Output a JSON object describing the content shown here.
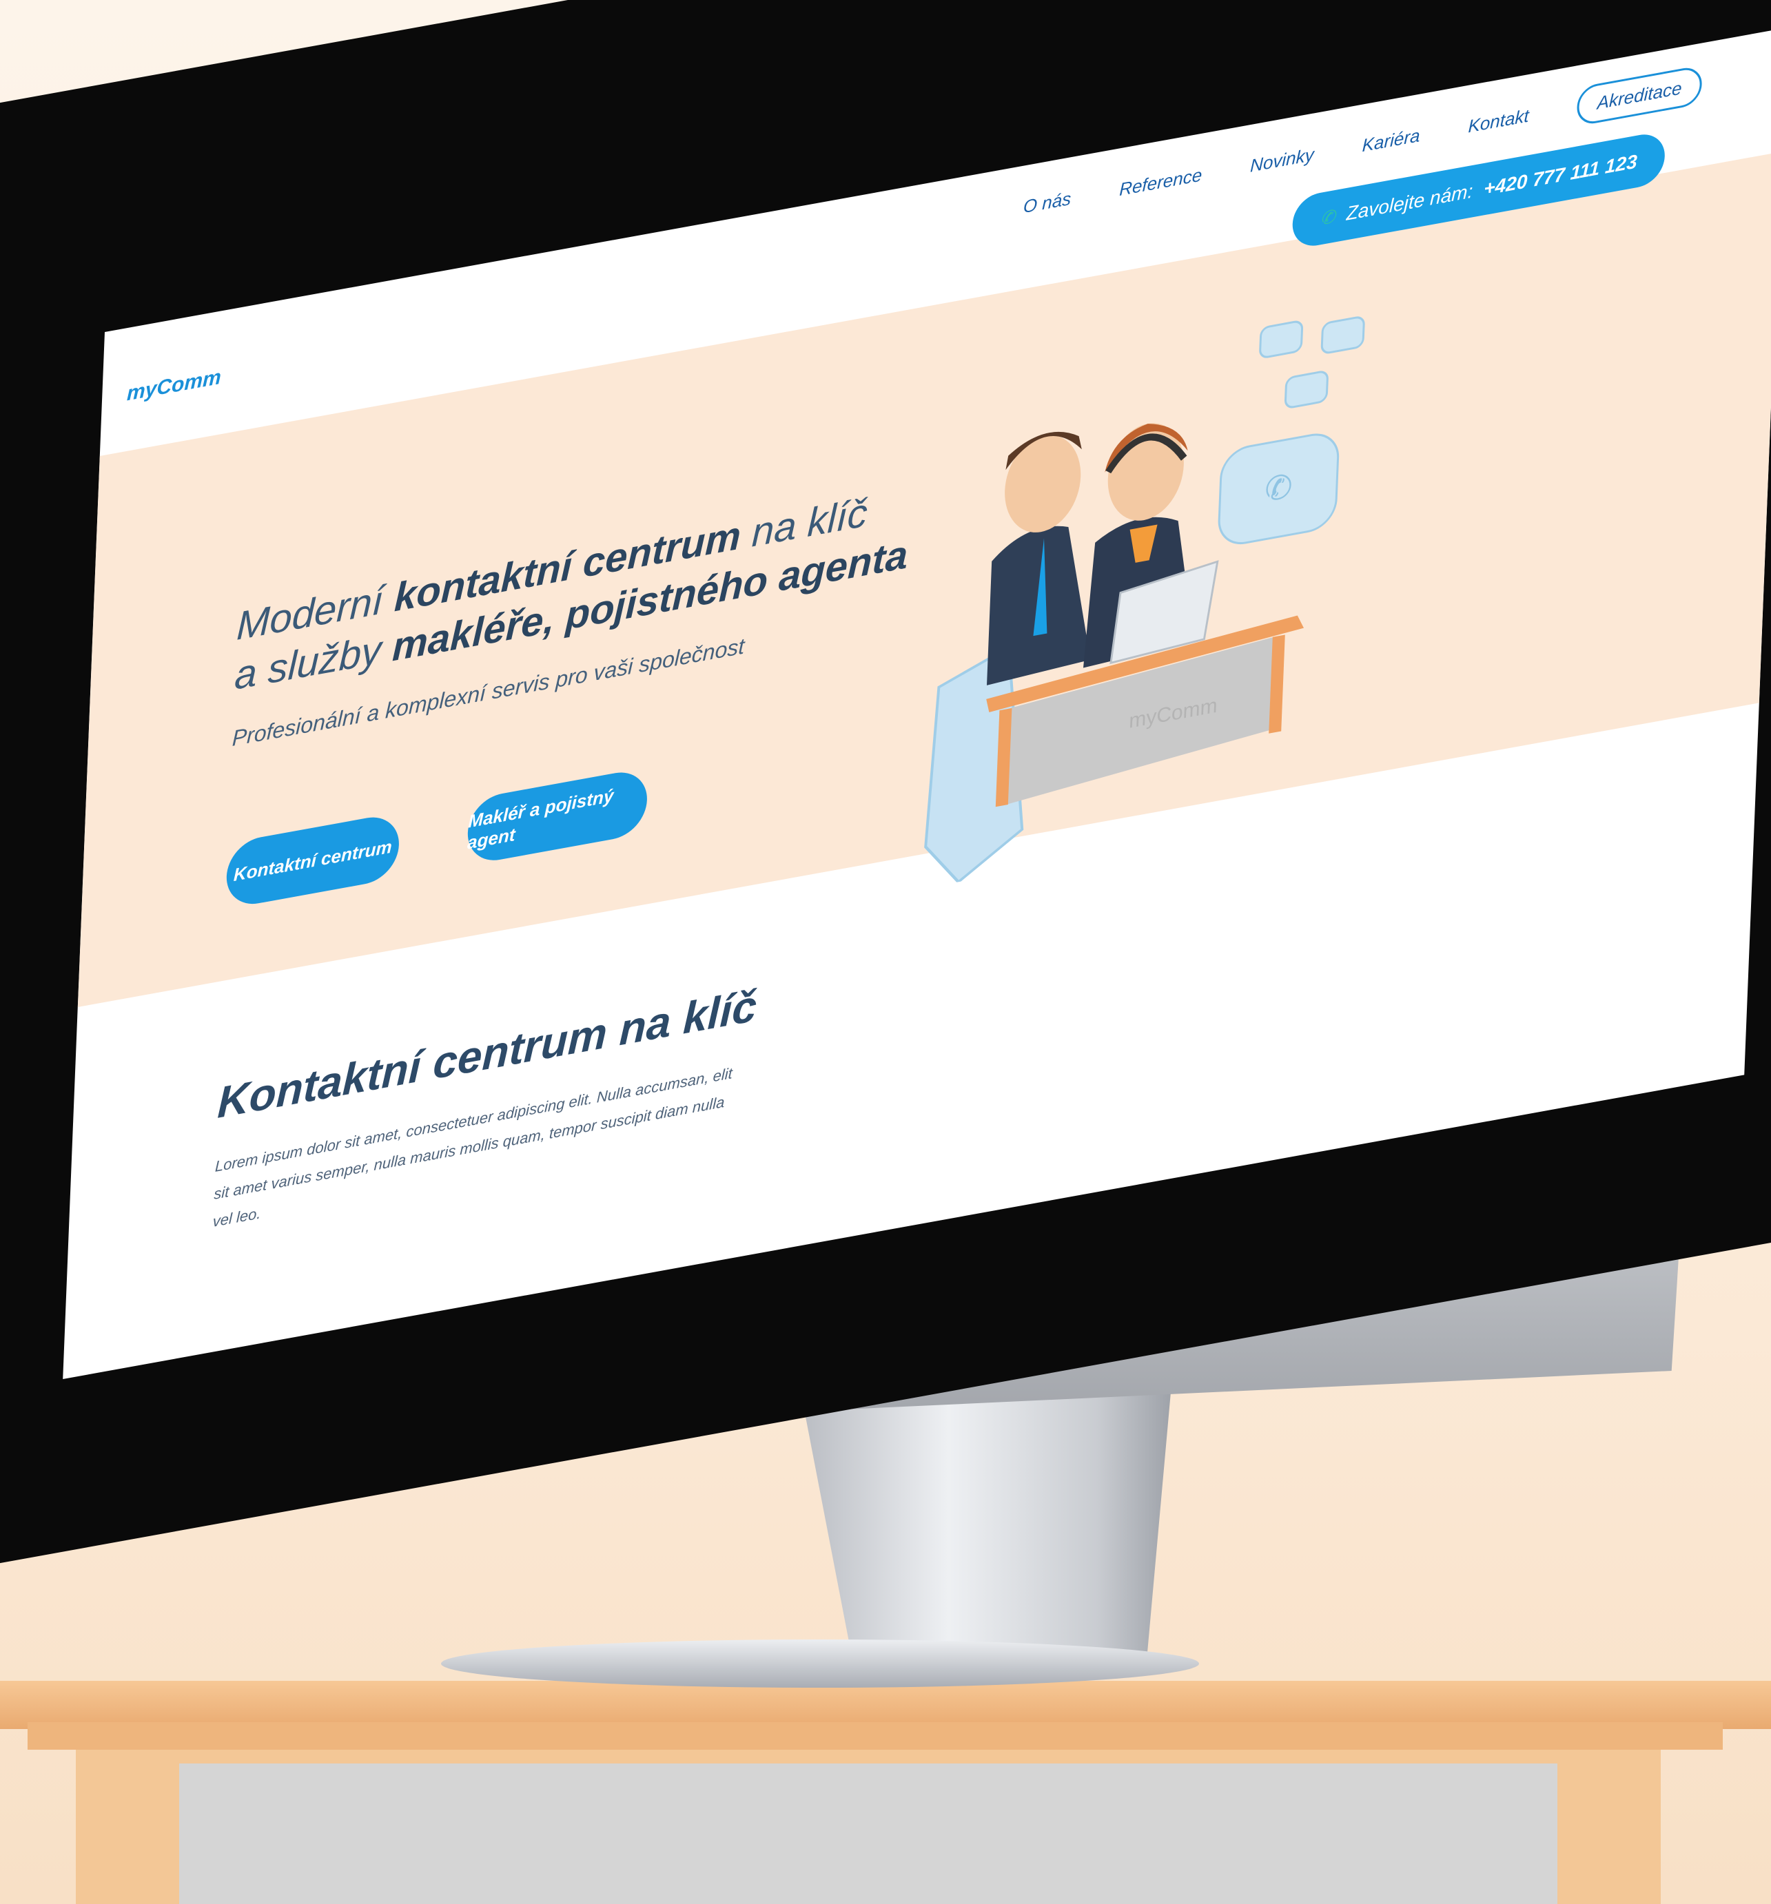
{
  "site": {
    "logo": "myComm",
    "nav": [
      "O nás",
      "Reference",
      "Novinky",
      "Kariéra",
      "Kontakt"
    ],
    "accreditation_button": "Akreditace",
    "phone_label": "Zavolejte nám:",
    "phone_number": "+420 777 111 123"
  },
  "hero": {
    "headline_1": "Moderní",
    "headline_2": "kontaktní centrum",
    "headline_3": "na klíč",
    "headline_4": "a služby",
    "headline_5": "makléře, pojistného agenta",
    "subline": "Profesionální a komplexní servis pro vaši společnost",
    "cta_primary": "Kontaktní centrum",
    "cta_secondary": "Makléř a pojistný agent",
    "desk_brand": "myComm"
  },
  "section": {
    "title": "Kontaktní centrum na klíč",
    "body": "Lorem ipsum dolor sit amet, consectetuer adipiscing elit. Nulla accumsan, elit sit amet varius semper, nulla mauris mollis quam, tempor suscipit diam nulla vel leo."
  },
  "colors": {
    "accent": "#1a9ae2",
    "hero_bg": "#fce8d6",
    "heading": "#2d4a68"
  }
}
